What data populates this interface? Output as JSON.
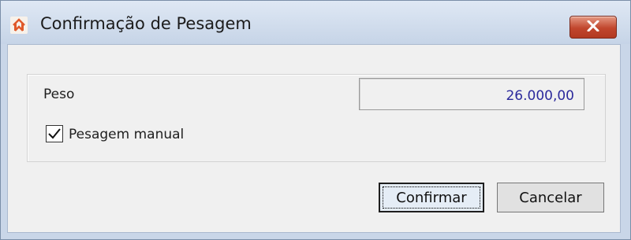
{
  "window": {
    "title": "Confirmação de Pesagem",
    "icon": "app-logo-icon",
    "close_icon": "close-icon"
  },
  "form": {
    "peso_label": "Peso",
    "peso_value": "26.000,00",
    "manual_checkbox_label": "Pesagem manual",
    "manual_checked": true
  },
  "buttons": {
    "confirm_label": "Confirmar",
    "cancel_label": "Cancelar"
  },
  "colors": {
    "value_text": "#2c2a9c",
    "close_button": "#c1462d",
    "title_bar": "#c6d4e7"
  }
}
